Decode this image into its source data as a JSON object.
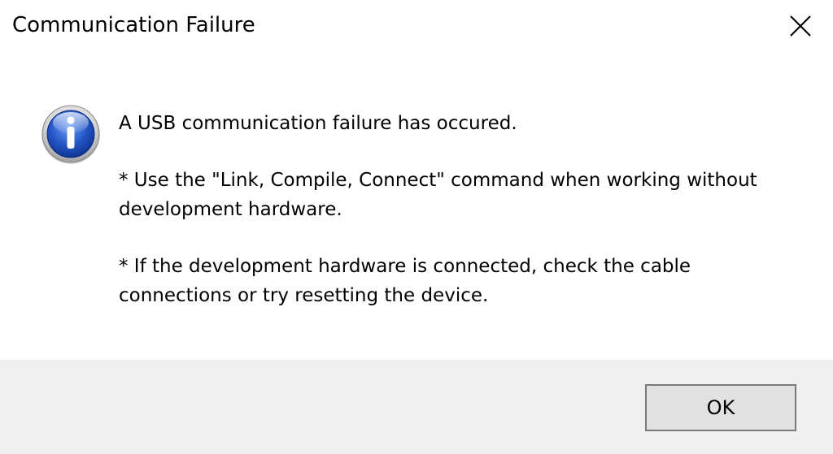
{
  "dialog": {
    "title": "Communication Failure",
    "close_icon": "close-icon",
    "info_icon": "information-icon",
    "message": {
      "line1": "A USB communication failure has occured.",
      "para2_line1": "* Use the \"Link, Compile, Connect\" command when working without",
      "para2_line2": "development hardware.",
      "para3_line1": "* If the development hardware is connected, check the cable",
      "para3_line2": "connections or try resetting the device."
    },
    "ok_label": "OK",
    "colors": {
      "footer_bg": "#f0f0f0",
      "button_bg": "#e1e1e1",
      "button_border": "#7a7a7a",
      "icon_blue": "#1c46b8"
    }
  }
}
